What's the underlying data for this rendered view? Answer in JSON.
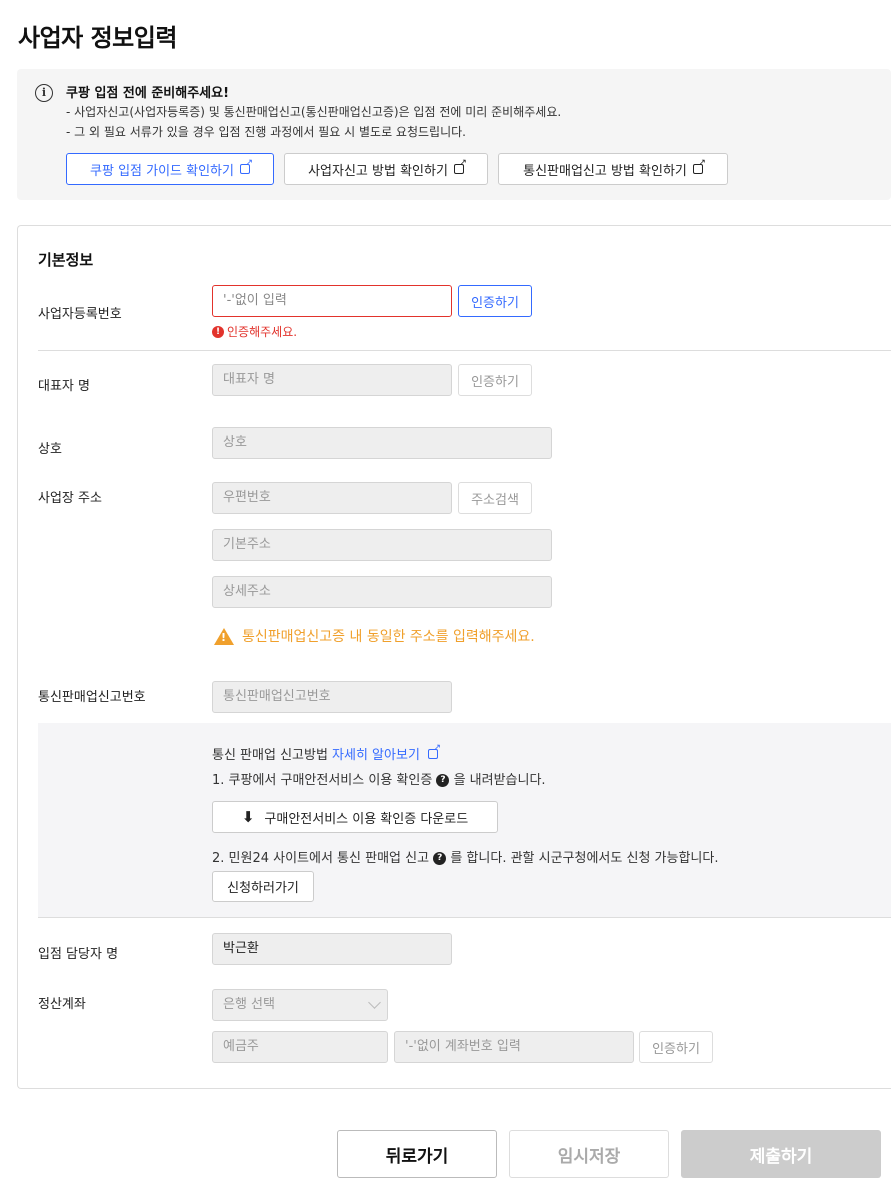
{
  "page_title": "사업자 정보입력",
  "notice": {
    "title": "쿠팡 입점 전에 준비해주세요!",
    "line1": "- 사업자신고(사업자등록증) 및 통신판매업신고(통신판매업신고증)은 입점 전에 미리 준비해주세요.",
    "line2": "- 그 외 필요 서류가 있을 경우 입점 진행 과정에서 필요 시 별도로 요청드립니다.",
    "buttons": [
      "쿠팡 입점 가이드 확인하기",
      "사업자신고 방법 확인하기",
      "통신판매업신고 방법 확인하기"
    ]
  },
  "form": {
    "section_title": "기본정보",
    "biz_number": {
      "label": "사업자등록번호",
      "placeholder": "'-'없이 입력",
      "button": "인증하기",
      "error": "인증해주세요."
    },
    "representative": {
      "label": "대표자 명",
      "placeholder": "대표자 명",
      "button": "인증하기"
    },
    "company": {
      "label": "상호",
      "placeholder": "상호"
    },
    "address": {
      "label": "사업장 주소",
      "zip_placeholder": "우편번호",
      "search_button": "주소검색",
      "basic_placeholder": "기본주소",
      "detail_placeholder": "상세주소",
      "warning": "통신판매업신고증 내 동일한 주소를 입력해주세요."
    },
    "mail_order": {
      "label": "통신판매업신고번호",
      "placeholder": "통신판매업신고번호"
    },
    "guide": {
      "heading": "통신 판매업 신고방법",
      "link": "자세히 알아보기",
      "step1_pre": "1. 쿠팡에서 구매안전서비스 이용 확인증",
      "step1_post": "을 내려받습니다.",
      "download_button": "구매안전서비스 이용 확인증 다운로드",
      "step2_pre": "2. 민원24 사이트에서 통신 판매업 신고",
      "step2_post": "를 합니다. 관할 시군구청에서도 신청 가능합니다.",
      "apply_button": "신청하러가기"
    },
    "manager": {
      "label": "입점 담당자 명",
      "value": "박근환"
    },
    "account": {
      "label": "정산계좌",
      "bank_select": "은행 선택",
      "holder_placeholder": "예금주",
      "number_placeholder": "'-'없이 계좌번호 입력",
      "button": "인증하기"
    }
  },
  "footer": {
    "back": "뒤로가기",
    "save": "임시저장",
    "submit": "제출하기"
  }
}
